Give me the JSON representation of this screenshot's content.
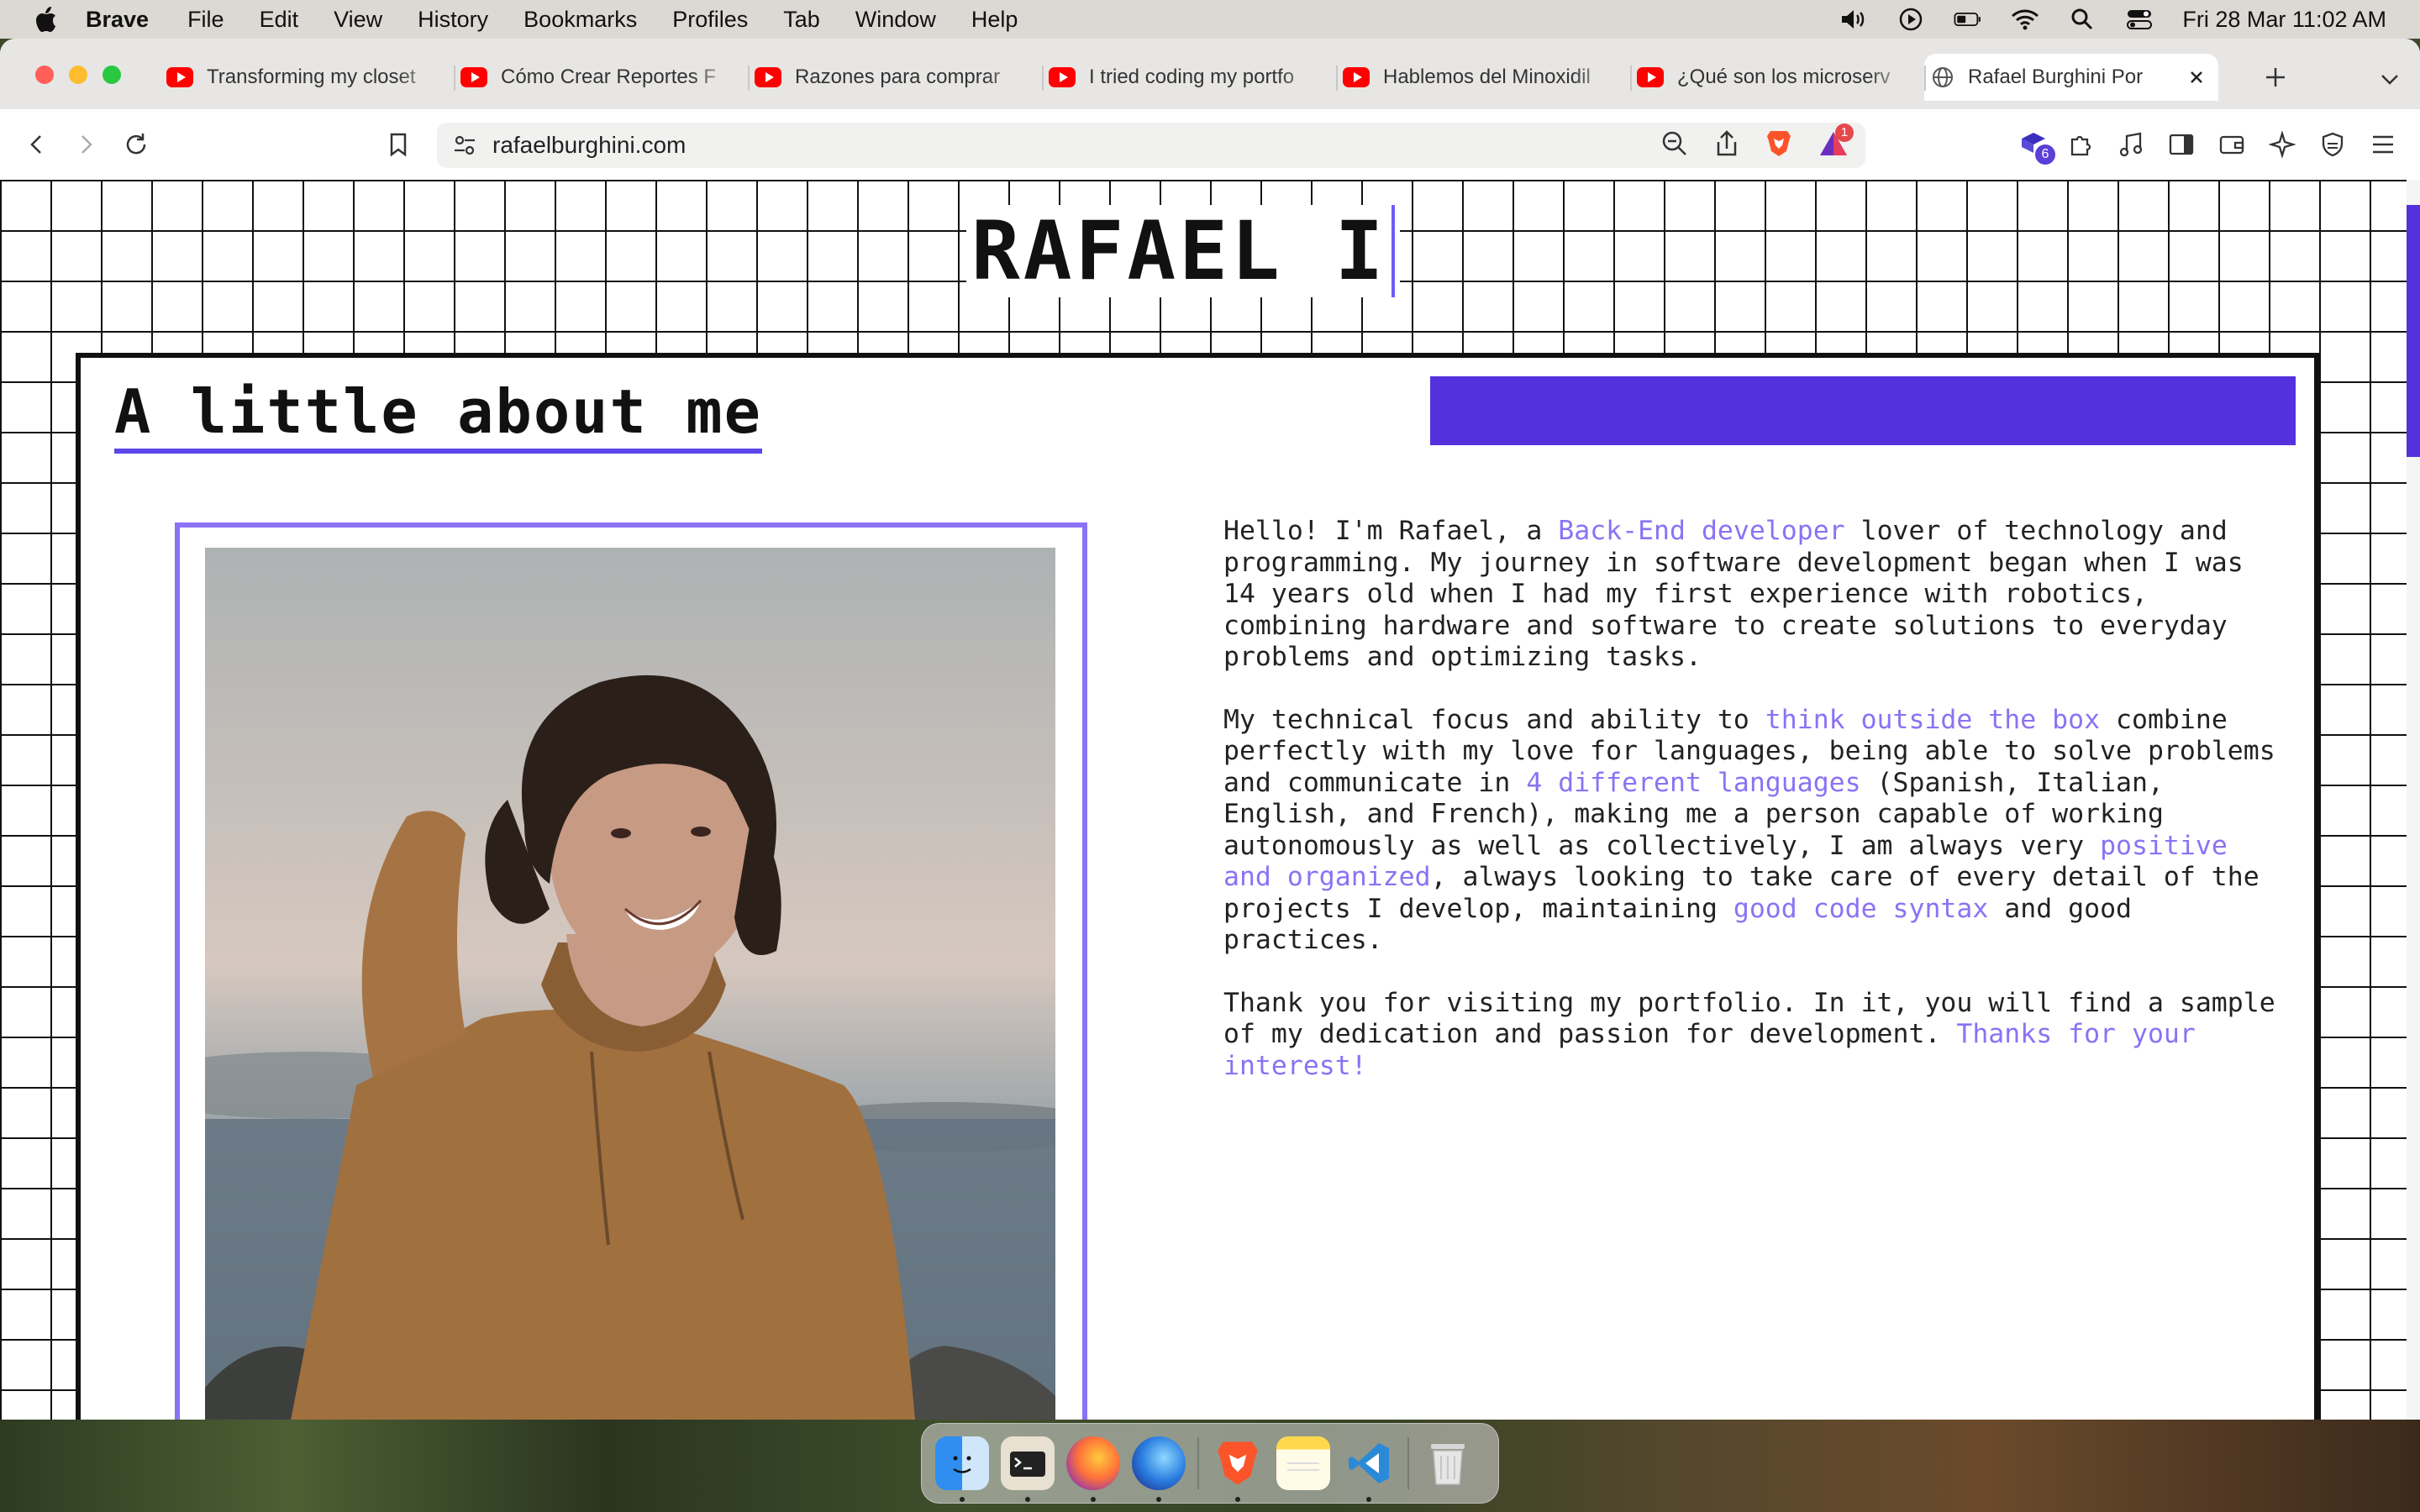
{
  "menubar": {
    "app_name": "Brave",
    "items": [
      "File",
      "Edit",
      "View",
      "History",
      "Bookmarks",
      "Profiles",
      "Tab",
      "Window",
      "Help"
    ],
    "clock": "Fri 28 Mar  11:02 AM",
    "status_icons": [
      "volume-icon",
      "play-icon",
      "battery-icon",
      "wifi-icon",
      "spotlight-icon",
      "control-center-icon"
    ]
  },
  "browser": {
    "tabs": [
      {
        "label": "Transforming my closet",
        "icon": "youtube-icon"
      },
      {
        "label": "Cómo Crear Reportes F",
        "icon": "youtube-icon"
      },
      {
        "label": "Razones para comprar",
        "icon": "youtube-icon"
      },
      {
        "label": "I tried coding my portfo",
        "icon": "youtube-icon"
      },
      {
        "label": "Hablemos del Minoxidil",
        "icon": "youtube-icon"
      },
      {
        "label": "¿Qué son los microserv",
        "icon": "youtube-icon"
      },
      {
        "label": "Rafael Burghini Por",
        "icon": "globe-icon",
        "active": true
      }
    ],
    "url": "rafaelburghini.com",
    "shields_badge": "1",
    "extensions_badge": "6"
  },
  "page": {
    "site_title": "RAFAEL I",
    "section_title": "A little about me",
    "accent_color": "#5431dc",
    "highlight_color": "#8b72f5",
    "paragraphs": [
      [
        {
          "t": "Hello! I'm Rafael, a "
        },
        {
          "t": "Back-End developer",
          "hl": true
        },
        {
          "t": " lover of technology and programming. My journey in software development began when I was 14 years old when I had my first experience with robotics, combining hardware and software to create solutions to everyday problems and optimizing tasks."
        }
      ],
      [
        {
          "t": "My technical focus and ability to "
        },
        {
          "t": "think outside the box",
          "hl": true
        },
        {
          "t": " combine perfectly with my love for languages, being able to solve problems and communicate in "
        },
        {
          "t": "4 different languages",
          "hl": true
        },
        {
          "t": " (Spanish, Italian, English, and French), making me a person capable of working autonomously as well as collectively, I am always very "
        },
        {
          "t": "positive and organized",
          "hl": true
        },
        {
          "t": ", always looking to take care of every detail of the projects I develop, maintaining "
        },
        {
          "t": "good code syntax",
          "hl": true
        },
        {
          "t": " and good practices."
        }
      ],
      [
        {
          "t": "Thank you for visiting my portfolio. In it, you will find a sample of my dedication and passion for development. "
        },
        {
          "t": "Thanks for your interest!",
          "hl": true
        }
      ]
    ]
  },
  "dock": {
    "apps": [
      "finder-icon",
      "terminal-icon",
      "firefox-icon",
      "firefox-developer-icon",
      "brave-icon",
      "notes-icon",
      "vscode-icon",
      "trash-icon"
    ]
  }
}
